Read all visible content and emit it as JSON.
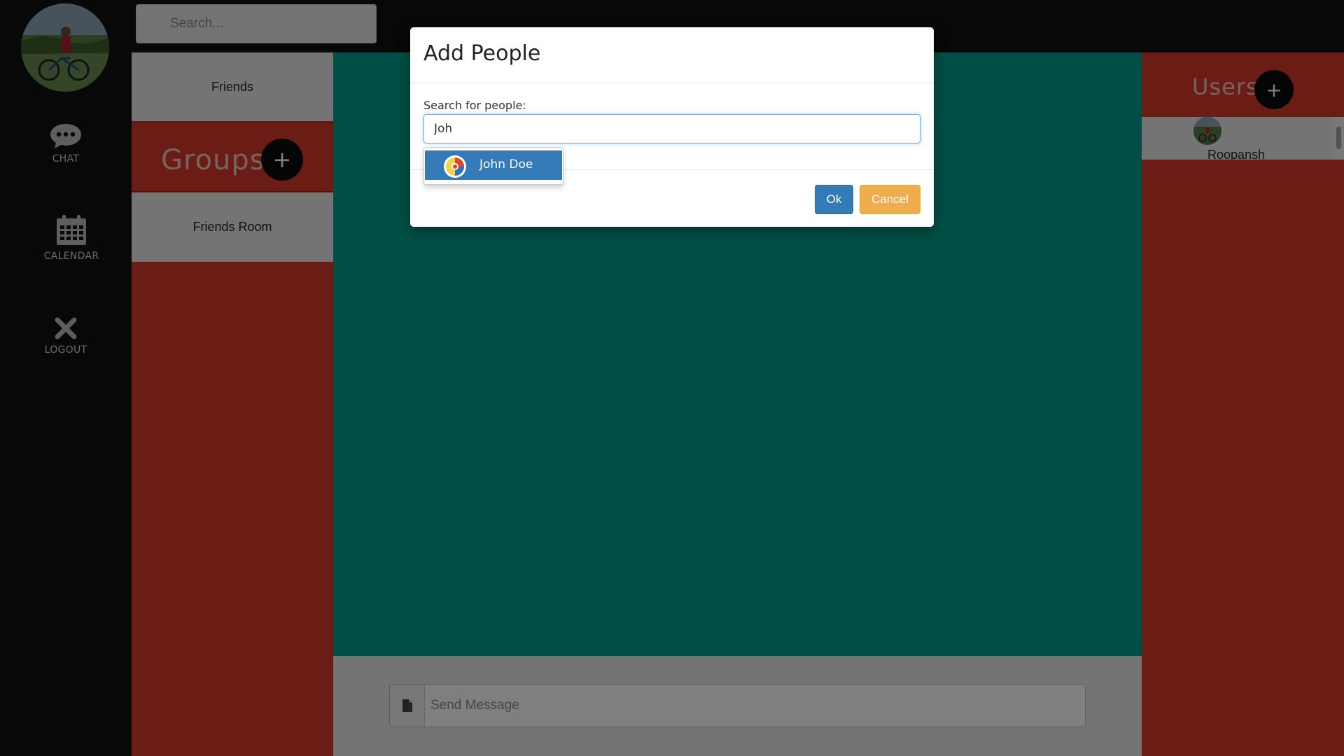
{
  "nav": {
    "chat_label": "CHAT",
    "calendar_label": "CALENDAR",
    "logout_label": "LOGOUT"
  },
  "top_search": {
    "placeholder": "Search..."
  },
  "groups_panel": {
    "friends_label": "Friends",
    "title": "Groups",
    "add_label": "+",
    "rooms": [
      {
        "label": "Friends Room"
      }
    ]
  },
  "users_panel": {
    "title": "Users",
    "add_label": "+",
    "users": [
      {
        "name": "Roopansh"
      }
    ]
  },
  "message_box": {
    "placeholder": "Send Message"
  },
  "modal": {
    "title": "Add People",
    "search_label": "Search for people:",
    "search_value": "Joh",
    "suggestions": [
      {
        "name": "John Doe"
      }
    ],
    "ok_label": "Ok",
    "cancel_label": "Cancel"
  },
  "colors": {
    "accent_red": "#d63a2a",
    "teal": "#009e8c",
    "primary_blue": "#337ab7",
    "warning_orange": "#f0ad4e",
    "sidebar_dark": "#111111"
  }
}
